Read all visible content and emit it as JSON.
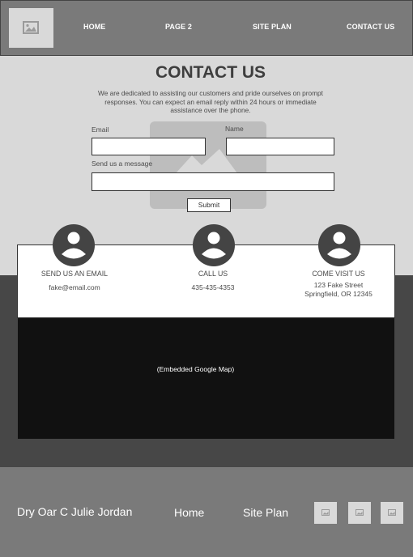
{
  "nav": {
    "home": "HOME",
    "page2": "PAGE 2",
    "site_plan": "SITE PLAN",
    "contact": "CONTACT US"
  },
  "contact": {
    "title": "CONTACT US",
    "intro": "We are dedicated to assisting our customers and pride ourselves on prompt responses. You can expect an email reply within 24 hours or immediate assistance over the phone.",
    "email_label": "Email",
    "name_label": "Name",
    "message_label": "Send us a message",
    "submit_label": "Submit"
  },
  "info": {
    "email": {
      "title": "SEND US AN EMAIL",
      "value": "fake@email.com"
    },
    "call": {
      "title": "CALL US",
      "value": "435-435-4353"
    },
    "visit": {
      "title": "COME VISIT US",
      "line1": "123 Fake Street",
      "line2": "Springfield, OR 12345"
    }
  },
  "map": {
    "label": "(Embedded Google Map)"
  },
  "footer": {
    "brand": "Dry Oar C Julie Jordan",
    "home": "Home",
    "site_plan": "Site Plan"
  },
  "colors": {
    "header": "#7a7a7a",
    "light": "#d9d9d9",
    "dark": "#474747",
    "map": "#111111",
    "icon": "#444444"
  },
  "icons": {
    "logo": "image-placeholder-icon",
    "social": [
      "image-placeholder-icon",
      "image-placeholder-icon",
      "image-placeholder-icon"
    ]
  }
}
